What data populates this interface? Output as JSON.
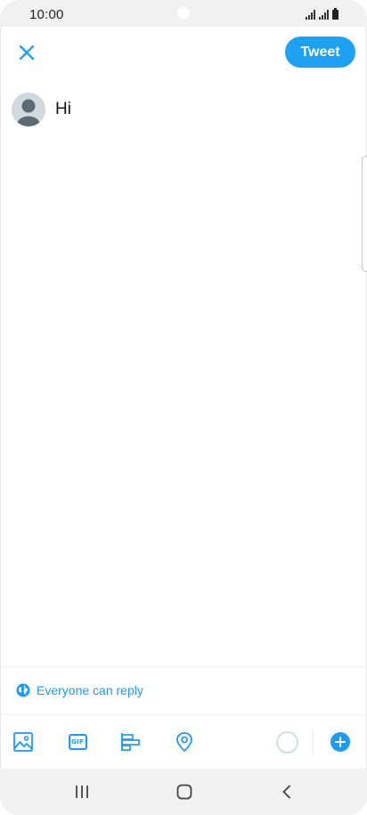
{
  "status_bar": {
    "time": "10:00"
  },
  "header": {
    "close_icon": "close-icon",
    "tweet_label": "Tweet"
  },
  "composer": {
    "avatar": "default-avatar",
    "text": "Hi"
  },
  "reply_setting": {
    "icon": "globe-icon",
    "label": "Everyone can reply"
  },
  "toolbar": {
    "icons": [
      "image-icon",
      "gif-icon",
      "poll-icon",
      "location-icon"
    ],
    "gif_label": "GIF",
    "add_icon": "plus-icon"
  },
  "navigation": {
    "icons": [
      "recent-apps-icon",
      "home-icon",
      "back-icon"
    ]
  },
  "colors": {
    "accent": "#1da1f2",
    "text": "#141414",
    "avatar_bg": "#cfd9de",
    "system_bar": "#f1f1f1"
  }
}
